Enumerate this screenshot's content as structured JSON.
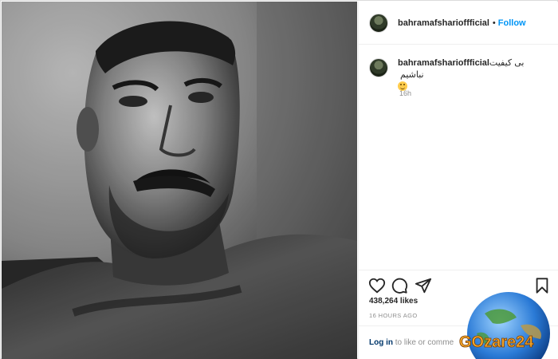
{
  "post": {
    "username": "bahramafsharioffficial",
    "follow_label": "Follow",
    "separator": "•"
  },
  "comment": {
    "username": "bahramafsharioffficial",
    "text": "بی کیفیت نباشیم",
    "time": "16h"
  },
  "stats": {
    "likes": "438,264 likes",
    "timestamp": "16 HOURS AGO"
  },
  "login": {
    "link": "Log in",
    "rest": "to like or comme"
  },
  "icons": [
    "heart-icon",
    "comment-icon",
    "share-icon",
    "bookmark-icon",
    "smile-emoji"
  ],
  "watermark": {
    "text": "GOzare24"
  },
  "colors": {
    "follow": "#0095f6",
    "secondary_text": "#8e8e8e",
    "border": "#dbdbdb",
    "link": "#00376b"
  }
}
